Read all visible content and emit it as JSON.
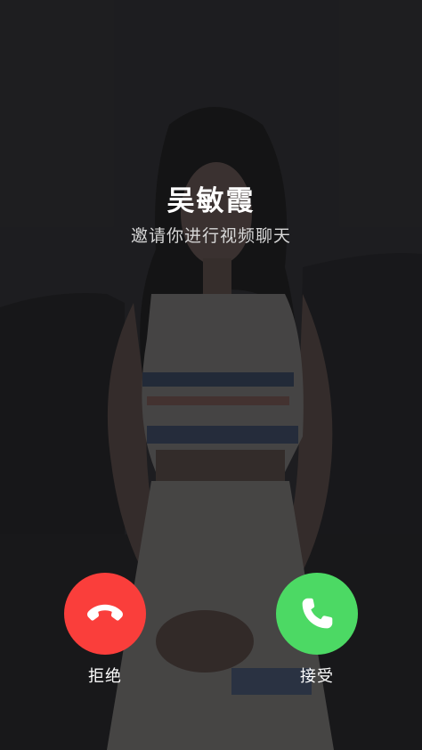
{
  "caller": {
    "name": "吴敏霞",
    "status": "邀请你进行视频聊天"
  },
  "actions": {
    "decline_label": "拒绝",
    "accept_label": "接受"
  },
  "icons": {
    "decline": "phone-hangup-icon",
    "accept": "phone-icon"
  },
  "colors": {
    "decline": "#fa3e3b",
    "accept": "#4cd964"
  }
}
